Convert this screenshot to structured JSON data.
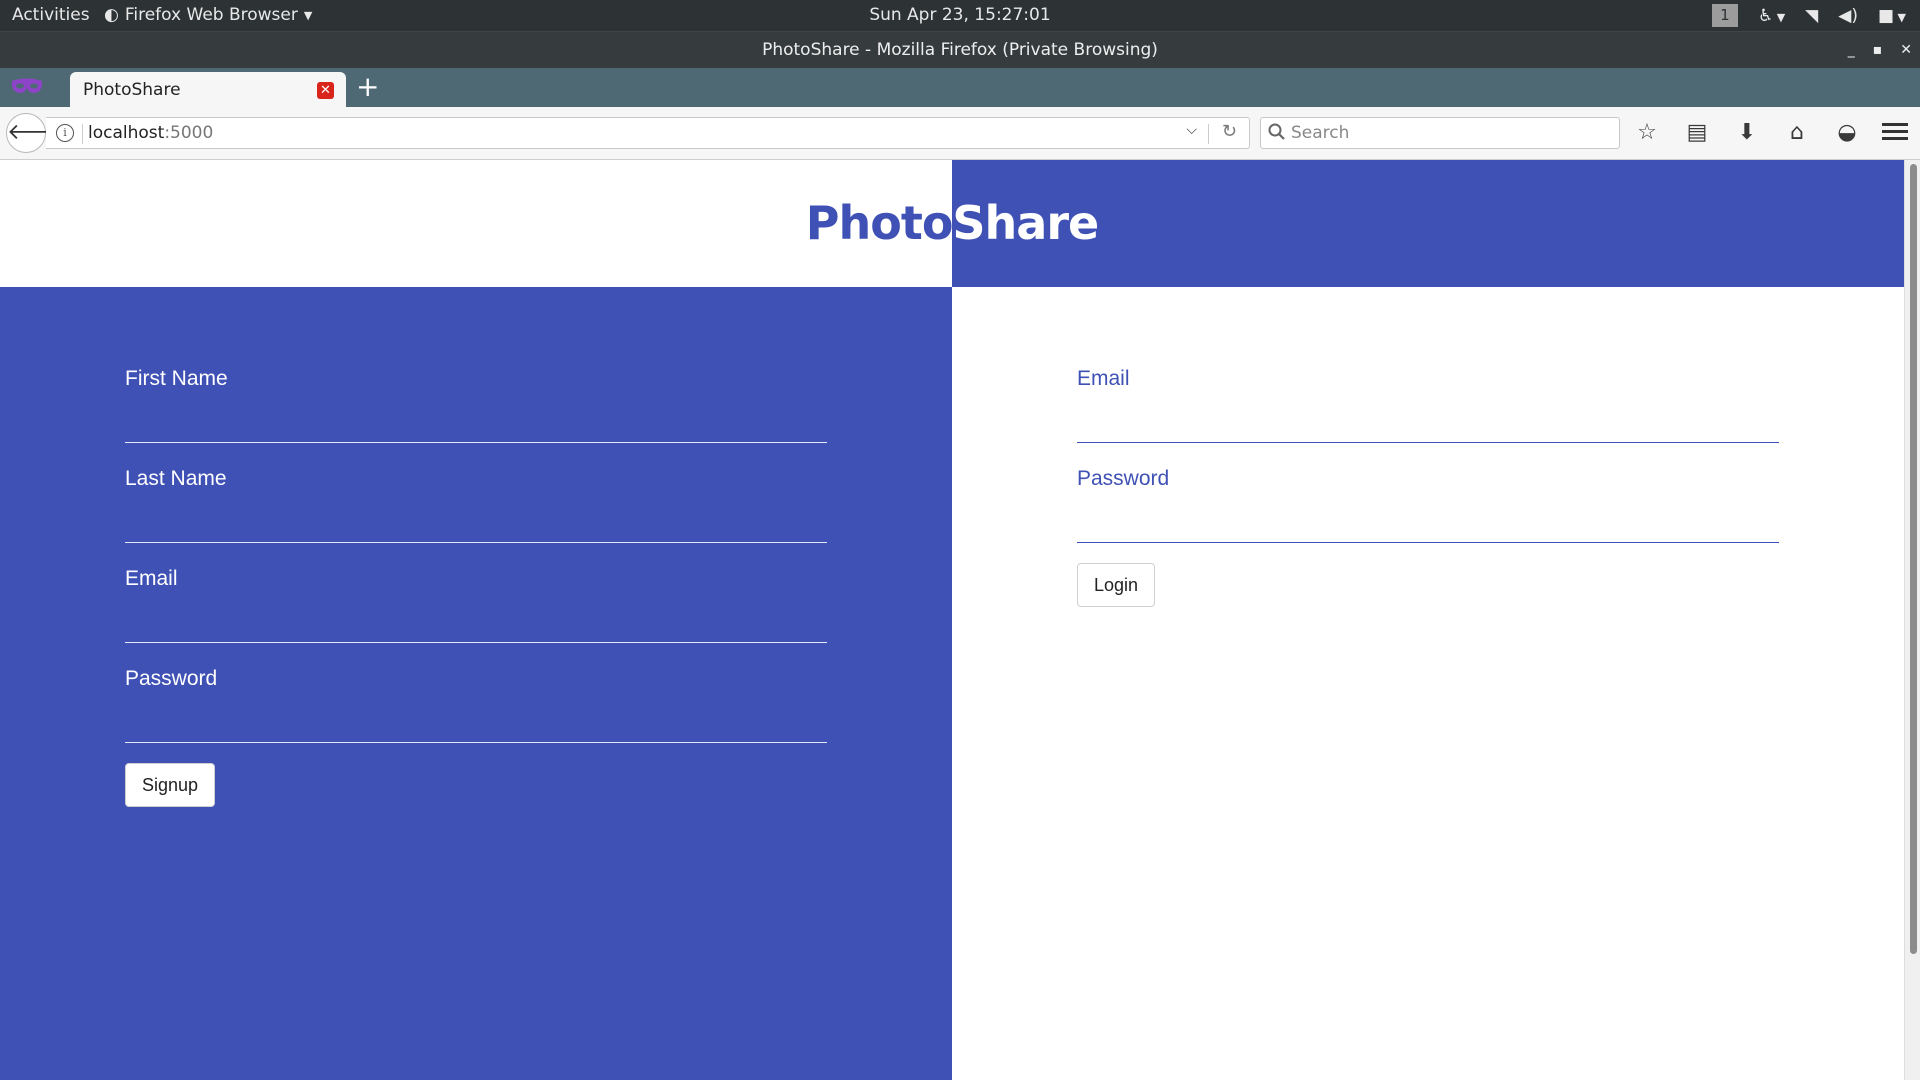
{
  "system_bar": {
    "activities": "Activities",
    "app_menu": "Firefox Web Browser",
    "clock": "Sun Apr 23, 15:27:01",
    "workspace": "1"
  },
  "window": {
    "title": "PhotoShare - Mozilla Firefox (Private Browsing)"
  },
  "tabs": [
    {
      "label": "PhotoShare"
    }
  ],
  "nav": {
    "url_host": "localhost",
    "url_port": ":5000",
    "search_placeholder": "Search"
  },
  "page": {
    "logo_left": "Photo",
    "logo_right": "Share",
    "brand_color": "#3f51b5",
    "signup": {
      "fields": [
        {
          "label": "First Name",
          "value": ""
        },
        {
          "label": "Last Name",
          "value": ""
        },
        {
          "label": "Email",
          "value": ""
        },
        {
          "label": "Password",
          "value": ""
        }
      ],
      "button": "Signup"
    },
    "login": {
      "fields": [
        {
          "label": "Email",
          "value": ""
        },
        {
          "label": "Password",
          "value": ""
        }
      ],
      "button": "Login"
    }
  }
}
